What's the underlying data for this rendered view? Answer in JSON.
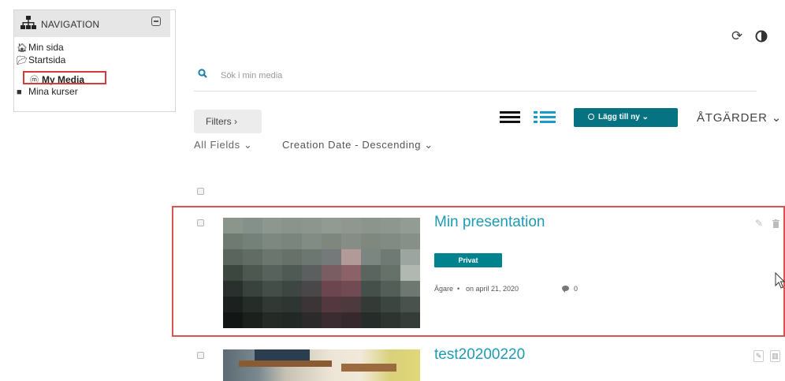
{
  "navigation": {
    "title": "NAVIGATION",
    "items": [
      {
        "label": "Min sida",
        "icon": "home-icon"
      },
      {
        "label": "Startsida",
        "icon": "folder-open-icon"
      },
      {
        "label": "My Media",
        "icon": "media-icon"
      },
      {
        "label": "Mina kurser",
        "icon": "folder-icon"
      }
    ]
  },
  "search": {
    "placeholder": "Sök i min media",
    "value": ""
  },
  "toolbar": {
    "filters_label": "Filters ›",
    "field_filter": "All Fields ⌄",
    "sort_filter": "Creation Date - Descending ⌄",
    "add_label": "Lägg till ny ⌄",
    "actions_label": "ÅTGÄRDER ⌄"
  },
  "entries": [
    {
      "title": "Min presentation",
      "badge": "Privat",
      "owner": "Ägare",
      "date_label": "on april 21, 2020",
      "comments": "0"
    },
    {
      "title": "test20200220"
    }
  ],
  "colors": {
    "accent": "#067383",
    "link": "#1e9bb4",
    "highlight": "#d9534f"
  }
}
